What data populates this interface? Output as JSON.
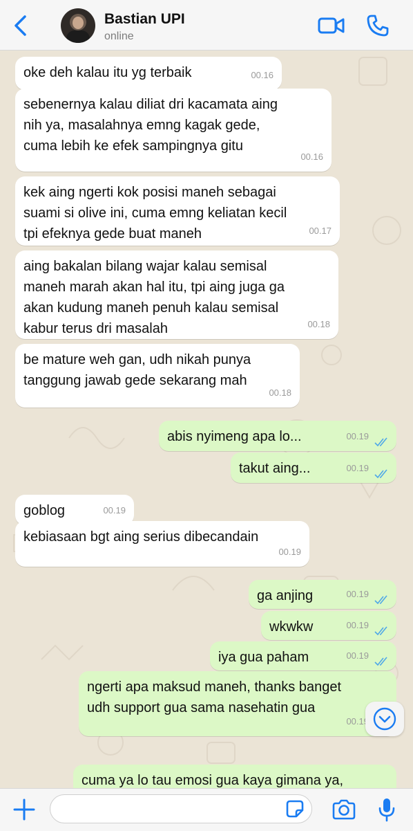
{
  "header": {
    "back_icon": "chevron-left-icon",
    "contact_name": "Bastian UPI",
    "status": "online",
    "video_icon": "video-call-icon",
    "phone_icon": "phone-call-icon"
  },
  "colors": {
    "accent": "#1a7cf2",
    "incoming_bubble": "#ffffff",
    "outgoing_bubble": "#dcf8c6",
    "read_ticks": "#4fa8e8"
  },
  "messages": [
    {
      "dir": "in",
      "text": "oke deh kalau itu yg terbaik",
      "time": "00.16"
    },
    {
      "dir": "in",
      "text": "sebenernya kalau diliat dri kacamata aing\nnih ya, masalahnya emng kagak gede,\ncuma lebih ke efek sampingnya gitu",
      "time": "00.16"
    },
    {
      "dir": "in",
      "text": "kek aing ngerti kok posisi maneh sebagai\nsuami si olive ini, cuma emng keliatan kecil\ntpi efeknya gede buat maneh",
      "time": "00.17"
    },
    {
      "dir": "in",
      "text": "aing bakalan bilang wajar kalau semisal\nmaneh marah akan hal itu, tpi aing juga ga\nakan kudung maneh penuh kalau semisal\nkabur terus dri masalah",
      "time": "00.18"
    },
    {
      "dir": "in",
      "text": "be mature weh gan, udh nikah punya\ntanggung jawab gede sekarang mah",
      "time": "00.18"
    },
    {
      "dir": "out",
      "text": "abis nyimeng apa lo...",
      "time": "00.19"
    },
    {
      "dir": "out",
      "text": "takut aing...",
      "time": "00.19"
    },
    {
      "dir": "in",
      "text": "goblog",
      "time": "00.19"
    },
    {
      "dir": "in",
      "text": "kebiasaan bgt aing serius dibecandain",
      "time": "00.19"
    },
    {
      "dir": "out",
      "text": "ga anjing",
      "time": "00.19"
    },
    {
      "dir": "out",
      "text": "wkwkw",
      "time": "00.19"
    },
    {
      "dir": "out",
      "text": "iya gua paham",
      "time": "00.19"
    },
    {
      "dir": "out",
      "text": "ngerti apa maksud maneh, thanks banget\nudh support gua sama nasehatin gua",
      "time": "00.19"
    },
    {
      "dir": "out",
      "text": "cuma ya lo tau emosi gua kaya gimana ya,\nemng ga ada niat kabur dri masalah kok",
      "time": ""
    }
  ],
  "scroll_down_icon": "chevron-down-circle-icon",
  "input": {
    "placeholder": "",
    "value": "",
    "plus_icon": "plus-icon",
    "sticker_icon": "sticker-icon",
    "camera_icon": "camera-icon",
    "mic_icon": "microphone-icon"
  }
}
